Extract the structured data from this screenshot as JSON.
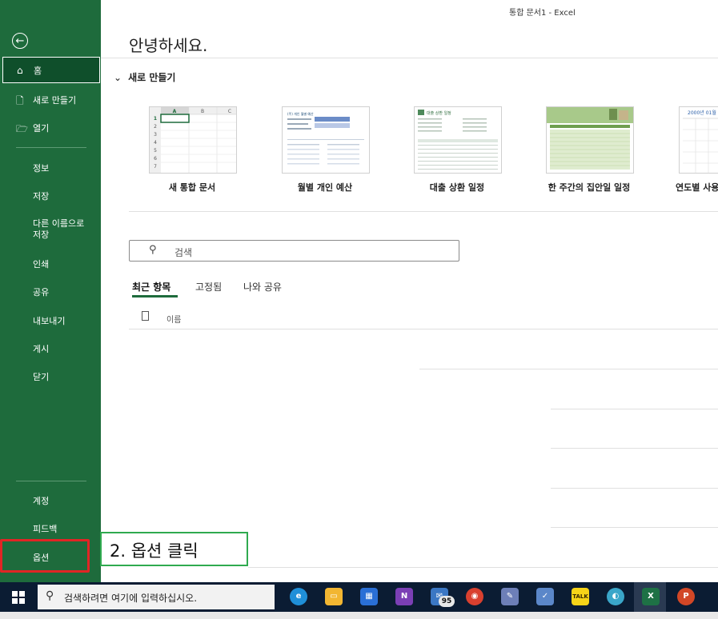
{
  "window": {
    "title": "통합 문서1  -  Excel"
  },
  "sidebar": {
    "back_icon": "back-arrow-icon",
    "primary": [
      {
        "label": "홈",
        "icon": "home-icon"
      },
      {
        "label": "새로 만들기",
        "icon": "new-document-icon"
      },
      {
        "label": "열기",
        "icon": "folder-open-icon"
      }
    ],
    "secondary": [
      "정보",
      "저장",
      "다른 이름으로\n저장",
      "인쇄",
      "공유",
      "내보내기",
      "게시",
      "닫기"
    ],
    "bottom": [
      "계정",
      "피드백",
      "옵션"
    ]
  },
  "main": {
    "greeting": "안녕하세요.",
    "new_section": {
      "title": "새로 만들기"
    },
    "templates": [
      {
        "label": "새 통합 문서"
      },
      {
        "label": "월별 개인 예산"
      },
      {
        "label": "대출 상환 일정"
      },
      {
        "label": "한 주간의 집안일 일정"
      },
      {
        "label": "연도별 사용"
      }
    ],
    "template_preview_text": {
      "blank_cols": [
        "A",
        "B",
        "C"
      ],
      "blank_rows": [
        "1",
        "2",
        "3",
        "4",
        "5",
        "6",
        "7"
      ],
      "budget_title": "(주) 개인 월별 예산",
      "loan_title": "대출 상환 일정",
      "calendar_title": "2000년 01월"
    },
    "search": {
      "placeholder": "검색"
    },
    "tabs": [
      "최근 항목",
      "고정됨",
      "나와 공유"
    ],
    "list_header": "이름"
  },
  "annotation": {
    "text": "2. 옵션 클릭"
  },
  "taskbar": {
    "search_placeholder": "검색하려면 여기에 입력하십시오.",
    "mail_badge": "95",
    "icons": [
      "edge-icon",
      "file-explorer-icon",
      "store-icon",
      "onenote-icon",
      "mail-icon",
      "chrome-icon",
      "paint-icon",
      "whiteboard-icon",
      "kakaotalk-icon",
      "vpn-icon",
      "excel-icon",
      "powerpoint-icon"
    ],
    "kakao_label": "TALK",
    "excel_label": "X",
    "ppt_label": "P",
    "onenote_label": "N"
  },
  "colors": {
    "accent": "#1e6b3c",
    "highlight_red": "#e12525",
    "annotation_green": "#2faa4f"
  }
}
